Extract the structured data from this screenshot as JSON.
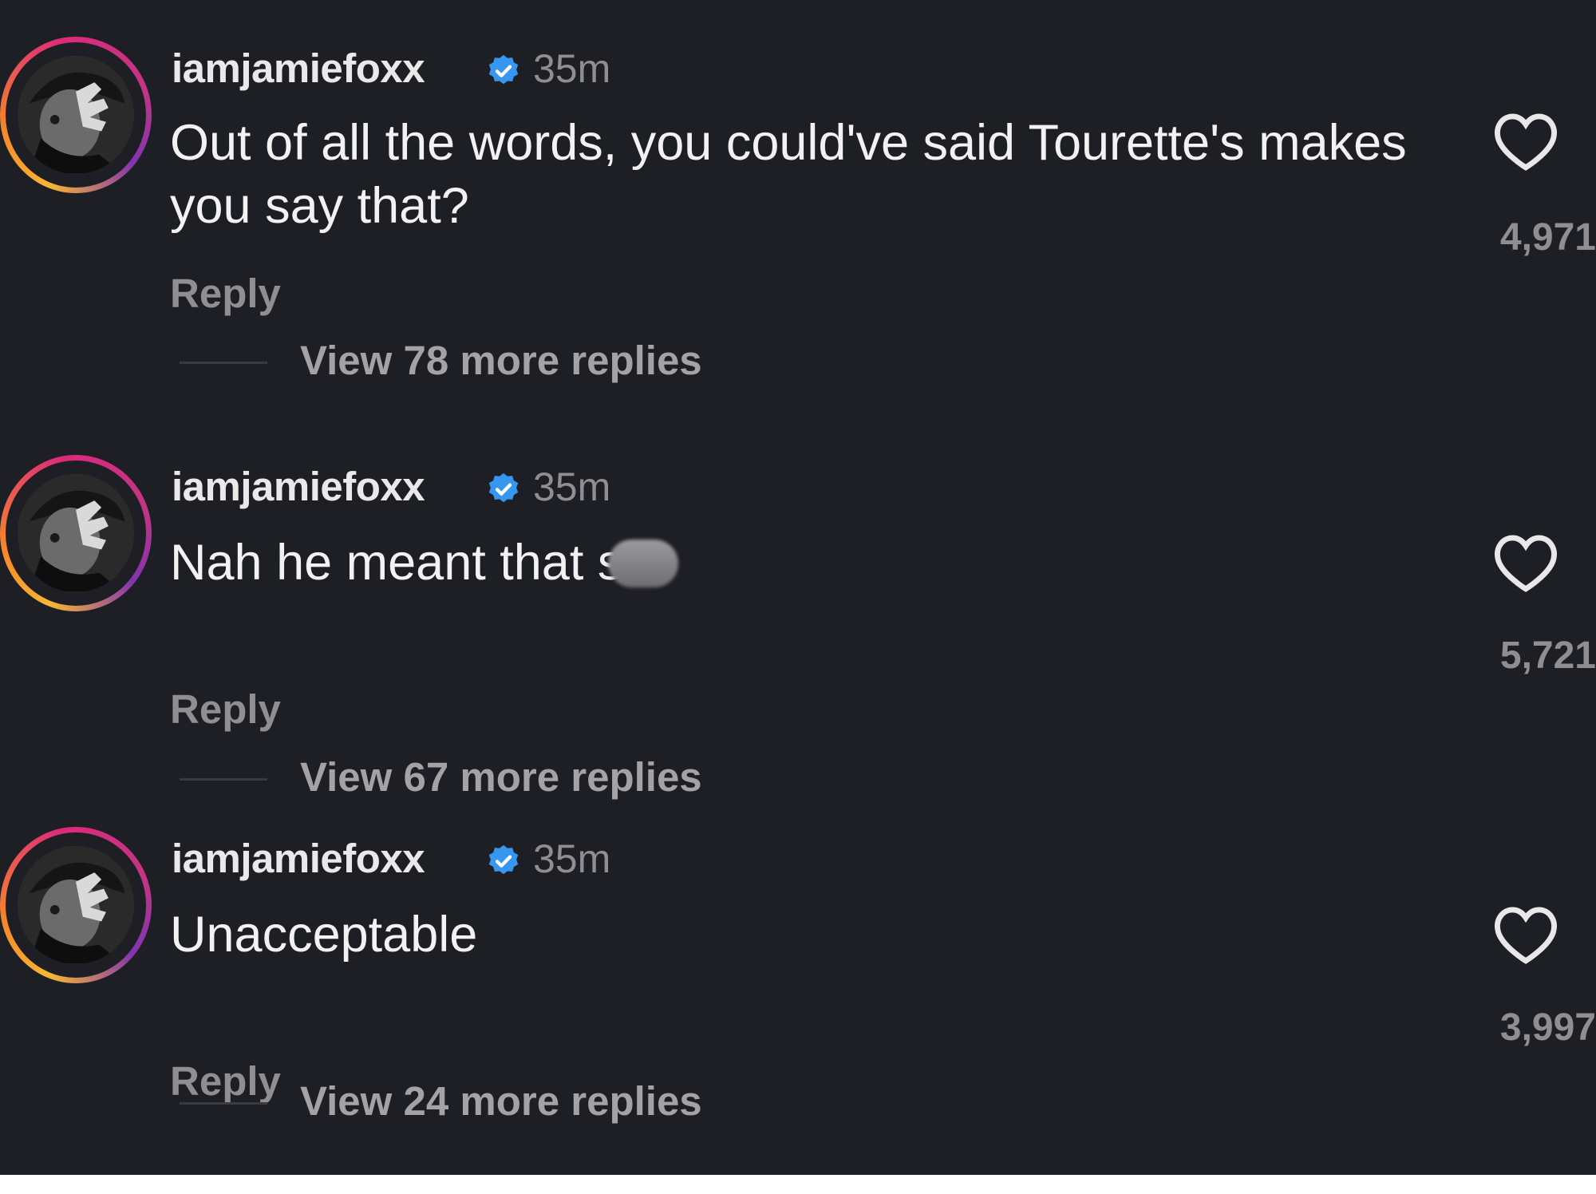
{
  "comments": [
    {
      "username": "iamjamiefoxx",
      "time": "35m",
      "text": "Out of all the words, you could've said Tourette's makes you say that?",
      "reply_label": "Reply",
      "view_more": "View 78 more replies",
      "likes": "4,971",
      "verified_icon": "verified-badge-icon",
      "like_icon": "heart-icon"
    },
    {
      "username": "iamjamiefoxx",
      "time": "35m",
      "text": "Nah he meant that s",
      "reply_label": "Reply",
      "view_more": "View 67 more replies",
      "likes": "5,721",
      "verified_icon": "verified-badge-icon",
      "like_icon": "heart-icon"
    },
    {
      "username": "iamjamiefoxx",
      "time": "35m",
      "text": "Unacceptable",
      "reply_label": "Reply",
      "view_more": "View 24 more replies",
      "likes": "3,997",
      "verified_icon": "verified-badge-icon",
      "like_icon": "heart-icon"
    }
  ],
  "colors": {
    "background": "#1e1f25",
    "username": "#e9e9ea",
    "secondary_text": "#8e8e93",
    "verified_blue": "#3797f0"
  }
}
